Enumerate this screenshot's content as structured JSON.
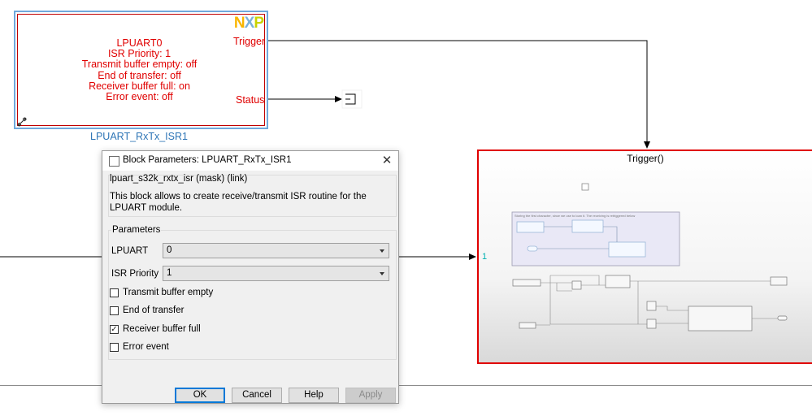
{
  "isr_block": {
    "logo": "NXP",
    "lines": [
      "LPUART0",
      "ISR Priority: 1",
      "Transmit buffer empty: off",
      "End of transfer: off",
      "Receiver buffer full: on",
      "Error event: off"
    ],
    "port_trigger": "Trigger",
    "port_status": "Status",
    "name": "LPUART_RxTx_ISR1"
  },
  "subsystem": {
    "title": "Trigger()",
    "input_port": "1",
    "preview_caption": "Storing the first character, since we use to loan it. The receiving is retriggered below"
  },
  "dialog": {
    "title": "Block Parameters: LPUART_RxTx_ISR1",
    "close_icon": "close-icon",
    "mask_title": "lpuart_s32k_rxtx_isr (mask) (link)",
    "mask_description": "This block allows to create receive/transmit ISR routine for the LPUART module.",
    "parameters_title": "Parameters",
    "lpuart_label": "LPUART",
    "lpuart_value": "0",
    "isr_priority_label": "ISR Priority",
    "isr_priority_value": "1",
    "checkboxes": [
      {
        "label": "Transmit buffer empty",
        "checked": false
      },
      {
        "label": "End of transfer",
        "checked": false
      },
      {
        "label": "Receiver buffer full",
        "checked": true
      },
      {
        "label": "Error event",
        "checked": false
      }
    ],
    "buttons": {
      "ok": "OK",
      "cancel": "Cancel",
      "help": "Help",
      "apply": "Apply"
    }
  },
  "colors": {
    "block_text": "#e00000",
    "block_name": "#2e75b6",
    "selection_border": "#6fa8dc",
    "subsystem_border": "#e00000",
    "port_number": "#00b0b0"
  }
}
